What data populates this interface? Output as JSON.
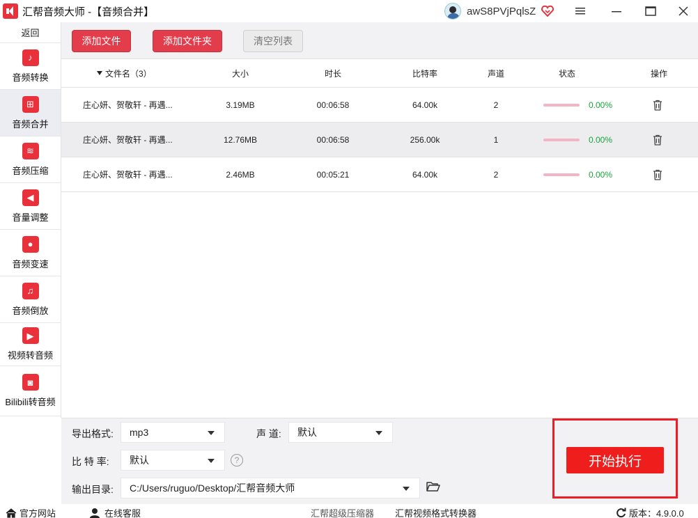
{
  "window": {
    "title": "汇帮音频大师 -【音频合并】",
    "username": "awS8PVjPqlsZ",
    "icons": [
      "app-logo-icon",
      "avatar-icon",
      "vip-heart-icon",
      "menu-icon",
      "minimize-icon",
      "maximize-icon",
      "close-icon"
    ]
  },
  "sidebar": {
    "back": "返回",
    "items": [
      {
        "label": "音频转换",
        "icon": "audio-convert-icon",
        "glyph": "♪"
      },
      {
        "label": "音频合并",
        "icon": "audio-merge-icon",
        "glyph": "⊞"
      },
      {
        "label": "音频压缩",
        "icon": "audio-compress-icon",
        "glyph": "≋"
      },
      {
        "label": "音量调整",
        "icon": "volume-icon",
        "glyph": "◀"
      },
      {
        "label": "音频变速",
        "icon": "microphone-icon",
        "glyph": "●"
      },
      {
        "label": "音频倒放",
        "icon": "music-note-icon",
        "glyph": "♫"
      },
      {
        "label": "视频转音频",
        "icon": "video-film-icon",
        "glyph": "▶"
      },
      {
        "label": "Bilibili转音频",
        "icon": "bilibili-tv-icon",
        "glyph": "◙"
      }
    ]
  },
  "toolbar": {
    "add_file": "添加文件",
    "add_folder": "添加文件夹",
    "clear_list": "清空列表"
  },
  "table": {
    "headers": {
      "filename": "文件名（3）",
      "size": "大小",
      "duration": "时长",
      "bitrate": "比特率",
      "channels": "声道",
      "status": "状态",
      "action": "操作"
    },
    "rows": [
      {
        "filename": "庄心妍、贺敬轩 - 再遇...",
        "size": "3.19MB",
        "duration": "00:06:58",
        "bitrate": "64.00k",
        "channels": "2",
        "progress": "0.00%"
      },
      {
        "filename": "庄心妍、贺敬轩 - 再遇...",
        "size": "12.76MB",
        "duration": "00:06:58",
        "bitrate": "256.00k",
        "channels": "1",
        "progress": "0.00%"
      },
      {
        "filename": "庄心妍、贺敬轩 - 再遇...",
        "size": "2.46MB",
        "duration": "00:05:21",
        "bitrate": "64.00k",
        "channels": "2",
        "progress": "0.00%"
      }
    ]
  },
  "settings": {
    "format_label": "导出格式:",
    "format_value": "mp3",
    "channel_label": "声 道:",
    "channel_value": "默认",
    "bitrate_label": "比 特 率:",
    "bitrate_value": "默认",
    "help": "?",
    "output_label": "输出目录:",
    "output_value": "C:/Users/ruguo/Desktop/汇帮音频大师",
    "start": "开始执行"
  },
  "footer": {
    "website": "官方网站",
    "support": "在线客服",
    "product1": "汇帮超级压缩器",
    "product2": "汇帮视频格式转换器",
    "version": "版本：4.9.0.0"
  },
  "colors": {
    "accent": "#e33c4b",
    "start": "#f01d1d",
    "progress_text": "#18a33a",
    "progress_bar": "#f2b5c3"
  }
}
